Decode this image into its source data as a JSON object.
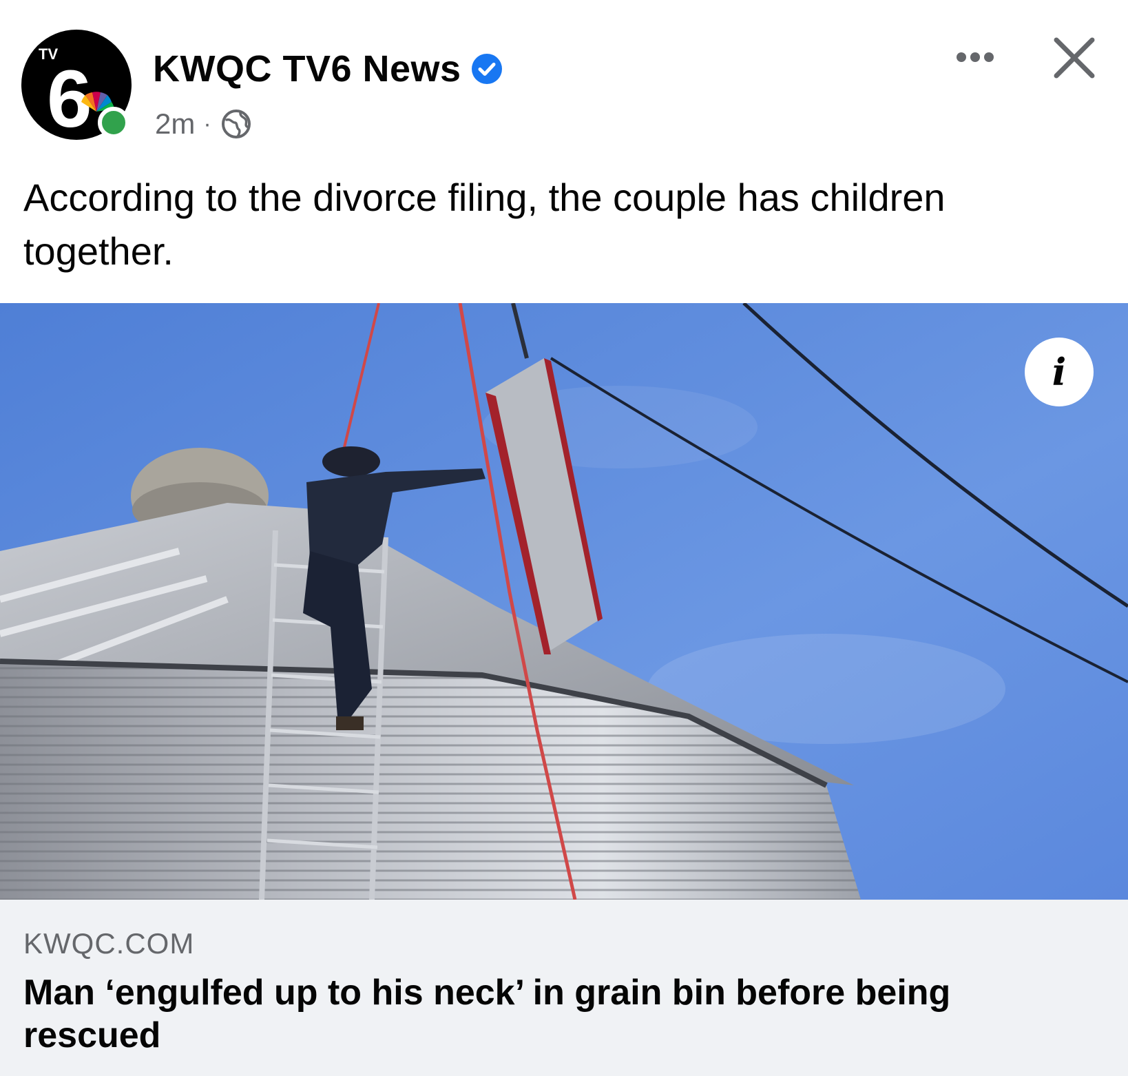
{
  "post": {
    "page_name": "KWQC TV6 News",
    "verified_icon": "verified-badge-icon",
    "time": "2m",
    "separator": "·",
    "audience_icon": "globe-icon",
    "more_icon": "more-options-icon",
    "close_icon": "close-icon",
    "caption": "According to the divorce filing, the couple has children together."
  },
  "avatar": {
    "logo_text": "TV",
    "logo_number": "6",
    "online_status_color": "#31a24c"
  },
  "media": {
    "info_icon": "info-icon",
    "info_label": "i",
    "image_description": "worker-on-grain-bin-photo"
  },
  "link_preview": {
    "domain": "KWQC.COM",
    "title": "Man ‘engulfed up to his neck’ in grain bin before being rescued"
  },
  "colors": {
    "verified": "#1877f2",
    "secondary_text": "#65676b",
    "card_background": "#f0f2f5"
  }
}
